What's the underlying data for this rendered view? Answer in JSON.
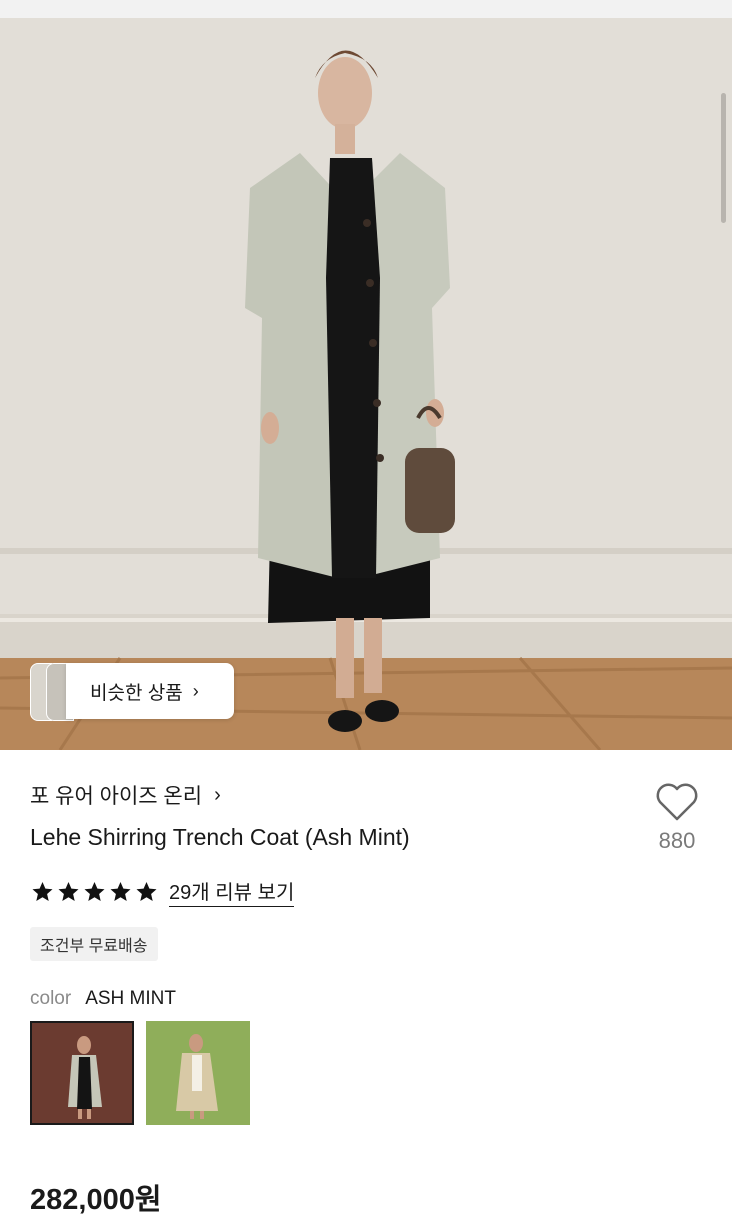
{
  "similar_button": {
    "label": "비슷한 상품",
    "chevron": "chevron-right-icon"
  },
  "product": {
    "brand": "포 유어 아이즈 온리",
    "title": "Lehe Shirring Trench Coat (Ash Mint)",
    "rating": 5,
    "reviews_link": "29개 리뷰 보기",
    "shipping_badge": "조건부 무료배송",
    "color_label": "color",
    "color_value": "ASH MINT",
    "price": "282,000원"
  },
  "like": {
    "icon": "heart-icon",
    "count": "880"
  },
  "colors": {
    "star": "#111111",
    "swatch_1_bg": "#6b3b30",
    "swatch_2_bg": "#8fae5a"
  }
}
